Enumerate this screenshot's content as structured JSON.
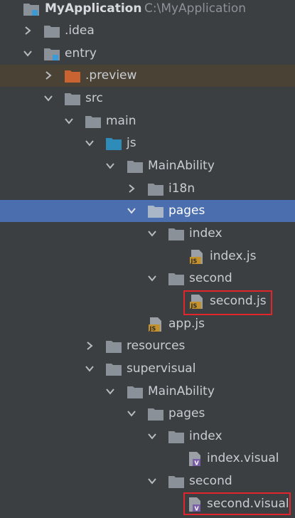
{
  "project": {
    "name": "MyApplication",
    "path": "C:\\MyApplication"
  },
  "nodes": {
    "idea": ".idea",
    "entry": "entry",
    "preview": ".preview",
    "src": "src",
    "main": "main",
    "js": "js",
    "js_mainability": "MainAbility",
    "i18n": "i18n",
    "js_pages": "pages",
    "js_index": "index",
    "index_js": "index.js",
    "js_second": "second",
    "second_js": "second.js",
    "app_js": "app.js",
    "resources": "resources",
    "supervisual": "supervisual",
    "sv_mainability": "MainAbility",
    "sv_pages": "pages",
    "sv_index": "index",
    "index_visual": "index.visual",
    "sv_second": "second",
    "second_visual": "second.visual"
  },
  "colors": {
    "folder": "#8b9198",
    "folder_blue": "#2f8cb8",
    "folder_orange": "#c96432",
    "js_badge": "#c4922c",
    "visual_badge": "#7b5ea8",
    "selection": "#4b6eaf",
    "callout": "#e0252b"
  },
  "icons": {
    "module": "module-folder-icon",
    "folder": "folder-icon",
    "js_file": "js-file-icon",
    "visual_file": "visual-file-icon",
    "chevron_right": "chevron-right-icon",
    "chevron_down": "chevron-down-icon"
  }
}
